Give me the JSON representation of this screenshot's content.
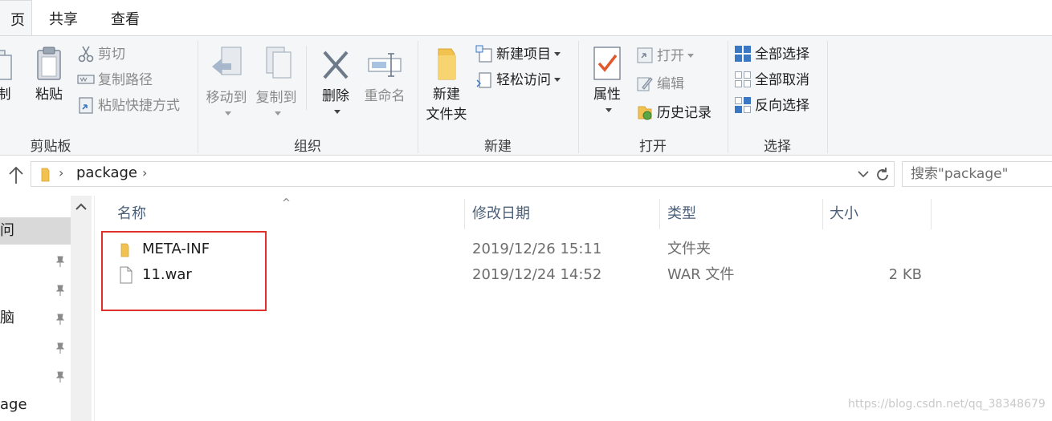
{
  "tabs": [
    {
      "label": "页",
      "active": true
    },
    {
      "label": "共享",
      "active": false
    },
    {
      "label": "查看",
      "active": false
    }
  ],
  "ribbon": {
    "clipboard": {
      "group_label": "剪贴板",
      "copy_label": "制",
      "paste_label": "粘贴",
      "cut_label": "剪切",
      "copy_path_label": "复制路径",
      "paste_shortcut_label": "粘贴快捷方式"
    },
    "organize": {
      "group_label": "组织",
      "move_to_label": "移动到",
      "copy_to_label": "复制到",
      "delete_label": "删除",
      "rename_label": "重命名"
    },
    "new": {
      "group_label": "新建",
      "new_folder_line1": "新建",
      "new_folder_line2": "文件夹",
      "new_item_label": "新建项目",
      "easy_access_label": "轻松访问"
    },
    "open": {
      "group_label": "打开",
      "properties_label": "属性",
      "open_label": "打开",
      "edit_label": "编辑",
      "history_label": "历史记录"
    },
    "select": {
      "group_label": "选择",
      "select_all_label": "全部选择",
      "select_none_label": "全部取消",
      "invert_label": "反向选择"
    }
  },
  "address": {
    "path": "package",
    "search_placeholder": "搜索\"package\""
  },
  "nav": {
    "items": [
      {
        "label": "问",
        "selected": true
      },
      {
        "label": "脑",
        "selected": false
      },
      {
        "label": "age",
        "selected": false
      }
    ]
  },
  "list": {
    "columns": {
      "name": "名称",
      "date": "修改日期",
      "type": "类型",
      "size": "大小"
    },
    "rows": [
      {
        "name": "META-INF",
        "date": "2019/12/26 15:11",
        "type": "文件夹",
        "size": "",
        "icon": "folder-icon"
      },
      {
        "name": "11.war",
        "date": "2019/12/24 14:52",
        "type": "WAR 文件",
        "size": "2 KB",
        "icon": "file-icon"
      }
    ]
  },
  "watermark": "https://blog.csdn.net/qq_38348679",
  "colors": {
    "ribbon_bg": "#f5f6f7",
    "highlight": "#e0302b",
    "header_text": "#4c607a",
    "folder": "#f2c250"
  }
}
